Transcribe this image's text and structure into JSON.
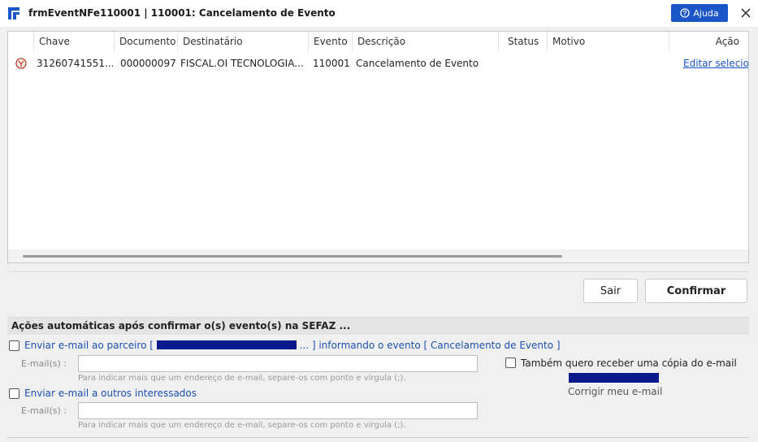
{
  "window": {
    "title": "frmEventNFe110001 | 110001: Cancelamento de Evento",
    "help_label": "Ajuda"
  },
  "grid": {
    "columns": [
      "Chave",
      "Documento",
      "Destinatário",
      "Evento",
      "Descrição",
      "Status",
      "Motivo",
      "Ação"
    ],
    "rows": [
      {
        "chave": "31260741551...",
        "documento": "000000097",
        "destinatario": "FISCAL.OI TECNOLOGIA...",
        "evento": "110001",
        "descricao": "Cancelamento de Evento",
        "status": "",
        "motivo": "",
        "acao": "Editar selecion"
      }
    ]
  },
  "buttons": {
    "sair": "Sair",
    "confirmar": "Confirmar"
  },
  "auto_actions": {
    "header": "Ações automáticas após confirmar o(s) evento(s) na SEFAZ ...",
    "partner_email": {
      "label_prefix": "Enviar e-mail ao parceiro [",
      "label_suffix": "... ] informando o evento [ Cancelamento de Evento ]",
      "checked": false,
      "field_label": "E-mail(s) :",
      "value": "",
      "hint": "Para indicar mais que um endereço de e-mail, separe-os com ponto e vírgula (;)."
    },
    "copy_email": {
      "label": "Também quero receber uma cópia do e-mail",
      "checked": false,
      "fix_label": "Corrigir meu e-mail"
    },
    "others_email": {
      "label": "Enviar e-mail a outros interessados",
      "checked": false,
      "field_label": "E-mail(s) :",
      "value": "",
      "hint": "Para indicar mais que um endereço de e-mail, separe-os com ponto e vírgula (;)."
    }
  },
  "colors": {
    "accent": "#1b56c8",
    "link": "#1b4fb0",
    "redaction": "#0a1a8c"
  }
}
